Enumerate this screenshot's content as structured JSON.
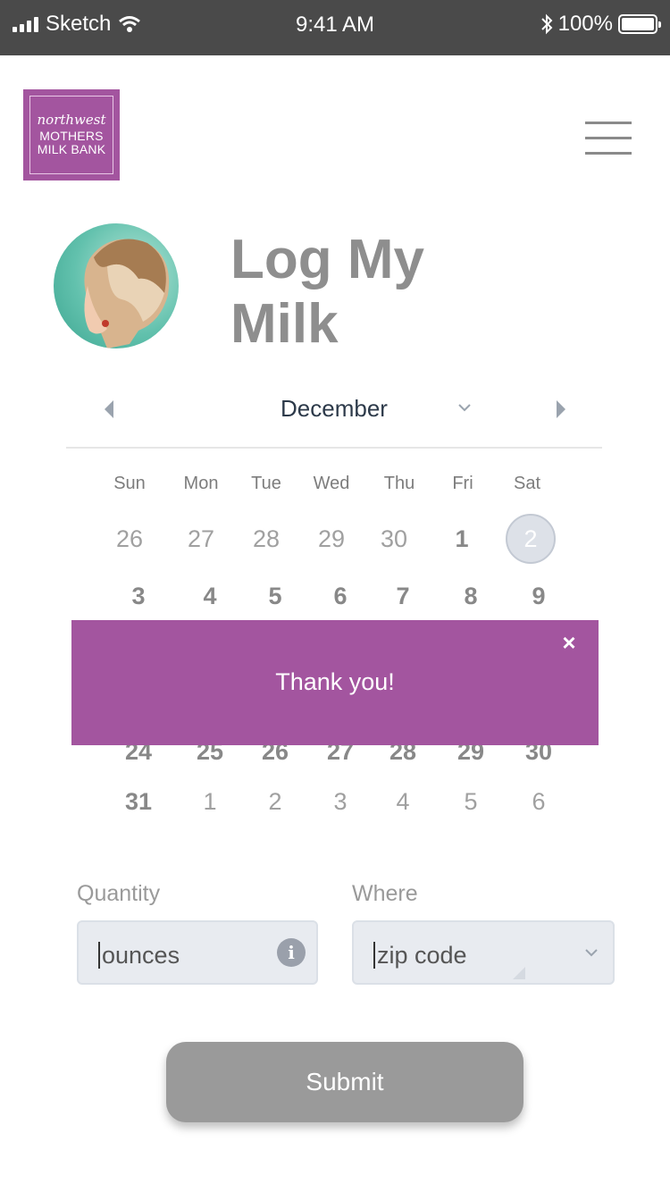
{
  "status_bar": {
    "carrier": "Sketch",
    "time": "9:41 AM",
    "battery": "100%"
  },
  "logo": {
    "line1": "northwest",
    "line2": "MOTHERS",
    "line3": "MILK BANK"
  },
  "page": {
    "title": "Log My Milk"
  },
  "calendar": {
    "month": "December",
    "weekdays": [
      "Sun",
      "Mon",
      "Tue",
      "Wed",
      "Thu",
      "Fri",
      "Sat"
    ],
    "row1": [
      "26",
      "27",
      "28",
      "29",
      "30",
      "1",
      "2"
    ],
    "row2": [
      "3",
      "4",
      "5",
      "6",
      "7",
      "8",
      "9"
    ],
    "row5": [
      "24",
      "25",
      "26",
      "27",
      "28",
      "29",
      "30"
    ],
    "row6": [
      "31",
      "1",
      "2",
      "3",
      "4",
      "5",
      "6"
    ],
    "selected": "2"
  },
  "toast": {
    "message": "Thank you!",
    "close": "×"
  },
  "form": {
    "quantity_label": "Quantity",
    "quantity_placeholder": "ounces",
    "where_label": "Where",
    "where_placeholder": "zip code",
    "submit_label": "Submit"
  },
  "colors": {
    "brand": "#a3559f",
    "status_bar": "#4a4a4a",
    "title_gray": "#8e8e8e",
    "button_gray": "#9a9a9a"
  }
}
